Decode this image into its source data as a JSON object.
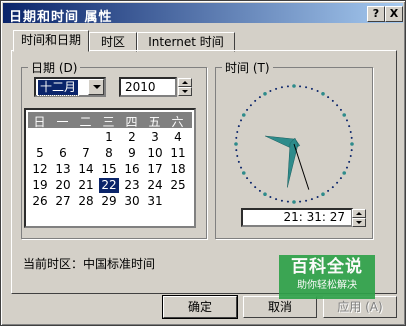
{
  "window": {
    "title": "日期和时间 属性",
    "help_btn": "?",
    "close_btn": "X"
  },
  "tabs": [
    {
      "label": "时间和日期",
      "active": true
    },
    {
      "label": "时区",
      "active": false
    },
    {
      "label": "Internet 时间",
      "active": false
    }
  ],
  "date_group": {
    "legend": "日期 (D)",
    "month": "十二月",
    "year": "2010",
    "weekdays": [
      "日",
      "一",
      "二",
      "三",
      "四",
      "五",
      "六"
    ],
    "days": [
      [
        "",
        "",
        "",
        "1",
        "2",
        "3",
        "4"
      ],
      [
        "5",
        "6",
        "7",
        "8",
        "9",
        "10",
        "11"
      ],
      [
        "12",
        "13",
        "14",
        "15",
        "16",
        "17",
        "18"
      ],
      [
        "19",
        "20",
        "21",
        "22",
        "23",
        "24",
        "25"
      ],
      [
        "26",
        "27",
        "28",
        "29",
        "30",
        "31",
        ""
      ]
    ],
    "selected_day": "22"
  },
  "time_group": {
    "legend": "时间 (T)",
    "time_value": "21: 31: 27"
  },
  "clock": {
    "hour": 9,
    "minute": 31,
    "second": 27
  },
  "timezone": {
    "label": "当前时区：",
    "value": "中国标准时间"
  },
  "buttons": {
    "ok": "确定",
    "cancel": "取消",
    "apply": "应用 (A)"
  },
  "watermark": {
    "title": "百科全说",
    "subtitle": "助你轻松解决"
  },
  "colors": {
    "titlebar": "#0a246a",
    "selection": "#0a246a",
    "clock_hands": "#2e8b8b",
    "watermark": "#2fa24a"
  }
}
